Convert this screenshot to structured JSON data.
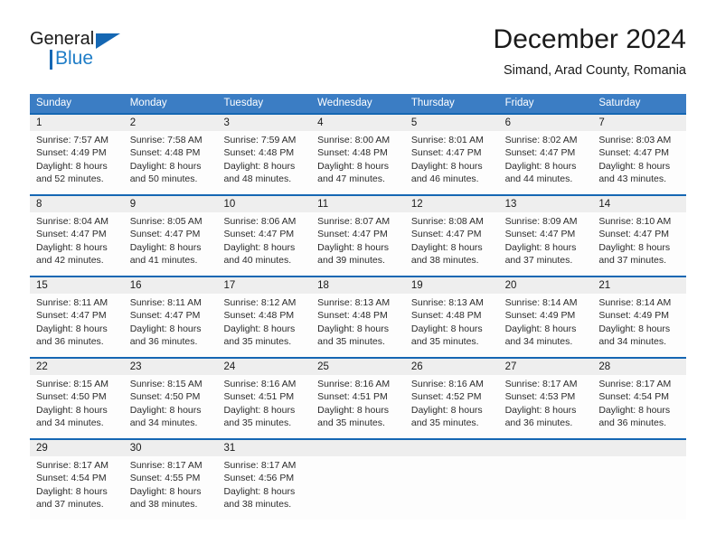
{
  "brand": {
    "name_part1": "General",
    "name_part2": "Blue",
    "logo_icon": "triangle-icon",
    "accent_color": "#1567b3"
  },
  "header": {
    "title": "December 2024",
    "subtitle": "Simand, Arad County, Romania"
  },
  "theme": {
    "header_bar_color": "#3b7dc4",
    "week_divider_color": "#1567b3",
    "daynum_row_color": "#eeeeee",
    "text_color": "#1a1a1a"
  },
  "weekdays": [
    "Sunday",
    "Monday",
    "Tuesday",
    "Wednesday",
    "Thursday",
    "Friday",
    "Saturday"
  ],
  "weeks": [
    {
      "days": [
        {
          "num": "1",
          "sunrise": "Sunrise: 7:57 AM",
          "sunset": "Sunset: 4:49 PM",
          "daylight_line1": "Daylight: 8 hours",
          "daylight_line2": "and 52 minutes."
        },
        {
          "num": "2",
          "sunrise": "Sunrise: 7:58 AM",
          "sunset": "Sunset: 4:48 PM",
          "daylight_line1": "Daylight: 8 hours",
          "daylight_line2": "and 50 minutes."
        },
        {
          "num": "3",
          "sunrise": "Sunrise: 7:59 AM",
          "sunset": "Sunset: 4:48 PM",
          "daylight_line1": "Daylight: 8 hours",
          "daylight_line2": "and 48 minutes."
        },
        {
          "num": "4",
          "sunrise": "Sunrise: 8:00 AM",
          "sunset": "Sunset: 4:48 PM",
          "daylight_line1": "Daylight: 8 hours",
          "daylight_line2": "and 47 minutes."
        },
        {
          "num": "5",
          "sunrise": "Sunrise: 8:01 AM",
          "sunset": "Sunset: 4:47 PM",
          "daylight_line1": "Daylight: 8 hours",
          "daylight_line2": "and 46 minutes."
        },
        {
          "num": "6",
          "sunrise": "Sunrise: 8:02 AM",
          "sunset": "Sunset: 4:47 PM",
          "daylight_line1": "Daylight: 8 hours",
          "daylight_line2": "and 44 minutes."
        },
        {
          "num": "7",
          "sunrise": "Sunrise: 8:03 AM",
          "sunset": "Sunset: 4:47 PM",
          "daylight_line1": "Daylight: 8 hours",
          "daylight_line2": "and 43 minutes."
        }
      ]
    },
    {
      "days": [
        {
          "num": "8",
          "sunrise": "Sunrise: 8:04 AM",
          "sunset": "Sunset: 4:47 PM",
          "daylight_line1": "Daylight: 8 hours",
          "daylight_line2": "and 42 minutes."
        },
        {
          "num": "9",
          "sunrise": "Sunrise: 8:05 AM",
          "sunset": "Sunset: 4:47 PM",
          "daylight_line1": "Daylight: 8 hours",
          "daylight_line2": "and 41 minutes."
        },
        {
          "num": "10",
          "sunrise": "Sunrise: 8:06 AM",
          "sunset": "Sunset: 4:47 PM",
          "daylight_line1": "Daylight: 8 hours",
          "daylight_line2": "and 40 minutes."
        },
        {
          "num": "11",
          "sunrise": "Sunrise: 8:07 AM",
          "sunset": "Sunset: 4:47 PM",
          "daylight_line1": "Daylight: 8 hours",
          "daylight_line2": "and 39 minutes."
        },
        {
          "num": "12",
          "sunrise": "Sunrise: 8:08 AM",
          "sunset": "Sunset: 4:47 PM",
          "daylight_line1": "Daylight: 8 hours",
          "daylight_line2": "and 38 minutes."
        },
        {
          "num": "13",
          "sunrise": "Sunrise: 8:09 AM",
          "sunset": "Sunset: 4:47 PM",
          "daylight_line1": "Daylight: 8 hours",
          "daylight_line2": "and 37 minutes."
        },
        {
          "num": "14",
          "sunrise": "Sunrise: 8:10 AM",
          "sunset": "Sunset: 4:47 PM",
          "daylight_line1": "Daylight: 8 hours",
          "daylight_line2": "and 37 minutes."
        }
      ]
    },
    {
      "days": [
        {
          "num": "15",
          "sunrise": "Sunrise: 8:11 AM",
          "sunset": "Sunset: 4:47 PM",
          "daylight_line1": "Daylight: 8 hours",
          "daylight_line2": "and 36 minutes."
        },
        {
          "num": "16",
          "sunrise": "Sunrise: 8:11 AM",
          "sunset": "Sunset: 4:47 PM",
          "daylight_line1": "Daylight: 8 hours",
          "daylight_line2": "and 36 minutes."
        },
        {
          "num": "17",
          "sunrise": "Sunrise: 8:12 AM",
          "sunset": "Sunset: 4:48 PM",
          "daylight_line1": "Daylight: 8 hours",
          "daylight_line2": "and 35 minutes."
        },
        {
          "num": "18",
          "sunrise": "Sunrise: 8:13 AM",
          "sunset": "Sunset: 4:48 PM",
          "daylight_line1": "Daylight: 8 hours",
          "daylight_line2": "and 35 minutes."
        },
        {
          "num": "19",
          "sunrise": "Sunrise: 8:13 AM",
          "sunset": "Sunset: 4:48 PM",
          "daylight_line1": "Daylight: 8 hours",
          "daylight_line2": "and 35 minutes."
        },
        {
          "num": "20",
          "sunrise": "Sunrise: 8:14 AM",
          "sunset": "Sunset: 4:49 PM",
          "daylight_line1": "Daylight: 8 hours",
          "daylight_line2": "and 34 minutes."
        },
        {
          "num": "21",
          "sunrise": "Sunrise: 8:14 AM",
          "sunset": "Sunset: 4:49 PM",
          "daylight_line1": "Daylight: 8 hours",
          "daylight_line2": "and 34 minutes."
        }
      ]
    },
    {
      "days": [
        {
          "num": "22",
          "sunrise": "Sunrise: 8:15 AM",
          "sunset": "Sunset: 4:50 PM",
          "daylight_line1": "Daylight: 8 hours",
          "daylight_line2": "and 34 minutes."
        },
        {
          "num": "23",
          "sunrise": "Sunrise: 8:15 AM",
          "sunset": "Sunset: 4:50 PM",
          "daylight_line1": "Daylight: 8 hours",
          "daylight_line2": "and 34 minutes."
        },
        {
          "num": "24",
          "sunrise": "Sunrise: 8:16 AM",
          "sunset": "Sunset: 4:51 PM",
          "daylight_line1": "Daylight: 8 hours",
          "daylight_line2": "and 35 minutes."
        },
        {
          "num": "25",
          "sunrise": "Sunrise: 8:16 AM",
          "sunset": "Sunset: 4:51 PM",
          "daylight_line1": "Daylight: 8 hours",
          "daylight_line2": "and 35 minutes."
        },
        {
          "num": "26",
          "sunrise": "Sunrise: 8:16 AM",
          "sunset": "Sunset: 4:52 PM",
          "daylight_line1": "Daylight: 8 hours",
          "daylight_line2": "and 35 minutes."
        },
        {
          "num": "27",
          "sunrise": "Sunrise: 8:17 AM",
          "sunset": "Sunset: 4:53 PM",
          "daylight_line1": "Daylight: 8 hours",
          "daylight_line2": "and 36 minutes."
        },
        {
          "num": "28",
          "sunrise": "Sunrise: 8:17 AM",
          "sunset": "Sunset: 4:54 PM",
          "daylight_line1": "Daylight: 8 hours",
          "daylight_line2": "and 36 minutes."
        }
      ]
    },
    {
      "days": [
        {
          "num": "29",
          "sunrise": "Sunrise: 8:17 AM",
          "sunset": "Sunset: 4:54 PM",
          "daylight_line1": "Daylight: 8 hours",
          "daylight_line2": "and 37 minutes."
        },
        {
          "num": "30",
          "sunrise": "Sunrise: 8:17 AM",
          "sunset": "Sunset: 4:55 PM",
          "daylight_line1": "Daylight: 8 hours",
          "daylight_line2": "and 38 minutes."
        },
        {
          "num": "31",
          "sunrise": "Sunrise: 8:17 AM",
          "sunset": "Sunset: 4:56 PM",
          "daylight_line1": "Daylight: 8 hours",
          "daylight_line2": "and 38 minutes."
        },
        {
          "num": "",
          "sunrise": "",
          "sunset": "",
          "daylight_line1": "",
          "daylight_line2": ""
        },
        {
          "num": "",
          "sunrise": "",
          "sunset": "",
          "daylight_line1": "",
          "daylight_line2": ""
        },
        {
          "num": "",
          "sunrise": "",
          "sunset": "",
          "daylight_line1": "",
          "daylight_line2": ""
        },
        {
          "num": "",
          "sunrise": "",
          "sunset": "",
          "daylight_line1": "",
          "daylight_line2": ""
        }
      ]
    }
  ]
}
